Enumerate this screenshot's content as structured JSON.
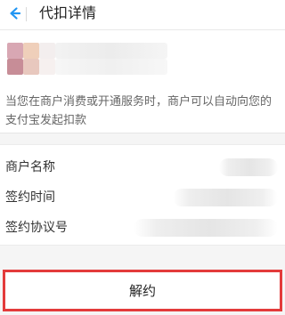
{
  "header": {
    "title": "代扣详情",
    "back_icon": "back-arrow-icon",
    "accent": "#2196f3"
  },
  "merchant": {
    "masked": true
  },
  "description": {
    "text": "当您在商户消费或开通服务时，商户可以自动向您的支付宝发起扣款"
  },
  "info": {
    "rows": [
      {
        "label": "商户名称"
      },
      {
        "label": "签约时间"
      },
      {
        "label": "签约协议号"
      }
    ]
  },
  "action": {
    "label": "解约",
    "highlight_color": "#e33b3b"
  }
}
